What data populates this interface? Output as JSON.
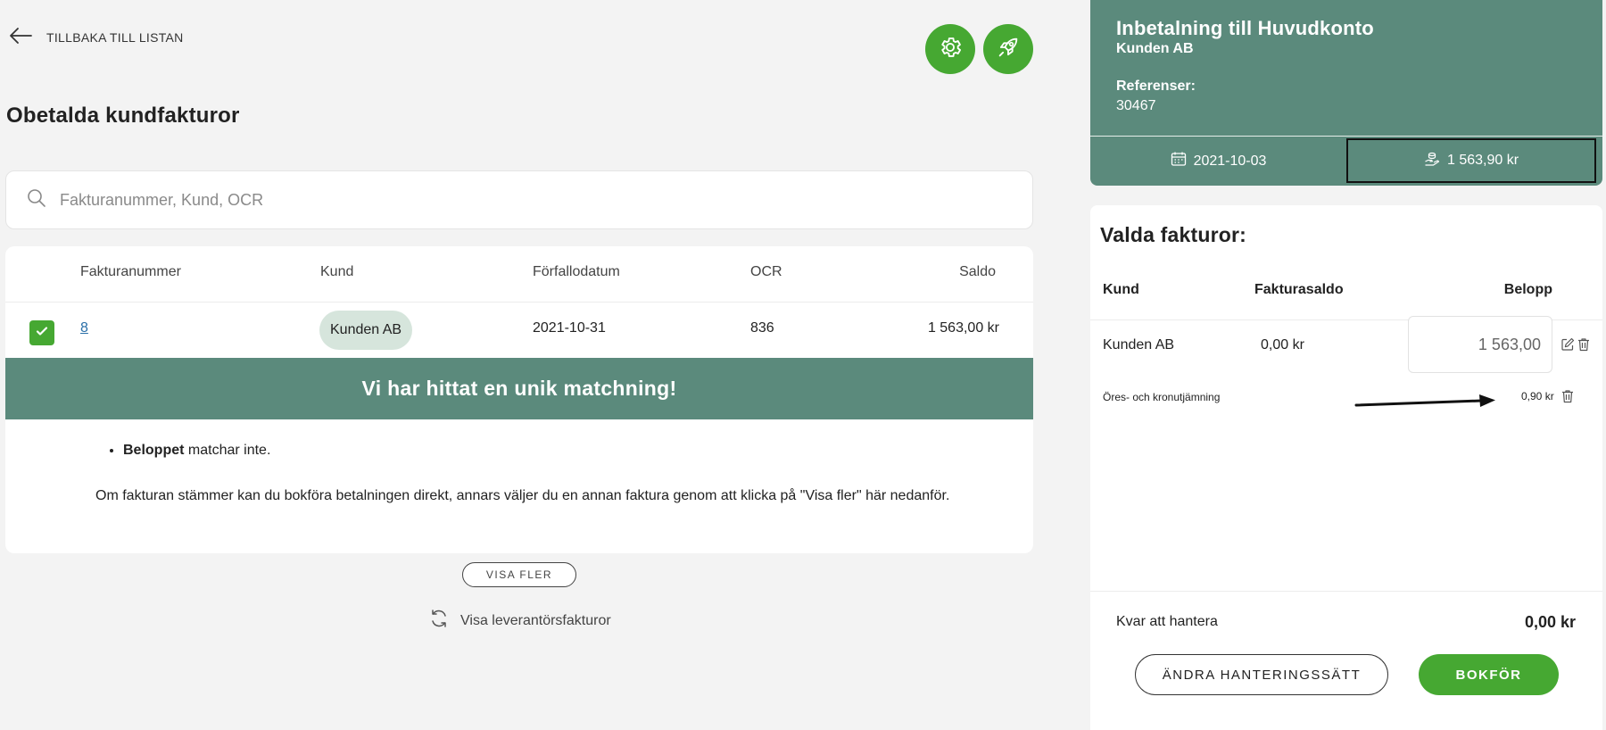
{
  "nav": {
    "back_label": "TILLBAKA TILL LISTAN"
  },
  "page": {
    "title": "Obetalda kundfakturor"
  },
  "search": {
    "placeholder": "Fakturanummer, Kund, OCR"
  },
  "table": {
    "headers": {
      "invoice_number": "Fakturanummer",
      "customer": "Kund",
      "due_date": "Förfallodatum",
      "ocr": "OCR",
      "balance": "Saldo"
    },
    "rows": [
      {
        "invoice_number": "8",
        "customer": "Kunden AB",
        "due_date": "2021-10-31",
        "ocr": "836",
        "balance": "1 563,00 kr",
        "checked": true
      }
    ]
  },
  "match": {
    "banner": "Vi har hittat en unik matchning!",
    "bullet_bold": "Beloppet",
    "bullet_rest": " matchar inte.",
    "description": "Om fakturan stämmer kan du bokföra betalningen direkt, annars väljer du en annan faktura genom att klicka på \"Visa fler\" här nedanför."
  },
  "actions": {
    "show_more": "VISA FLER",
    "show_supplier": "Visa leverantörsfakturor"
  },
  "payment": {
    "title": "Inbetalning till Huvudkonto",
    "customer": "Kunden AB",
    "references_label": "Referenser:",
    "reference": "30467",
    "date": "2021-10-03",
    "amount": "1 563,90 kr"
  },
  "selected": {
    "title": "Valda fakturor:",
    "headers": {
      "customer": "Kund",
      "invoice_balance": "Fakturasaldo",
      "amount": "Belopp"
    },
    "rows": [
      {
        "customer": "Kunden AB",
        "invoice_balance": "0,00 kr",
        "amount": "1 563,00"
      }
    ],
    "rounding": {
      "label": "Öres- och kronutjämning",
      "amount": "0,90 kr"
    },
    "remaining_label": "Kvar att hantera",
    "remaining_value": "0,00 kr",
    "change_button": "ÄNDRA HANTERINGSSÄTT",
    "book_button": "BOKFÖR"
  },
  "colors": {
    "accent_green": "#46a832",
    "header_teal": "#5b8a7c",
    "chip_bg": "#d6e5dc",
    "background": "#f3f3f3"
  },
  "icons": {
    "back": "arrow-left-icon",
    "settings": "gear-icon",
    "launch": "rocket-icon",
    "search": "search-icon",
    "refresh": "refresh-icon",
    "calendar": "calendar-icon",
    "money": "money-hand-icon",
    "edit": "edit-icon",
    "delete": "trash-icon"
  }
}
